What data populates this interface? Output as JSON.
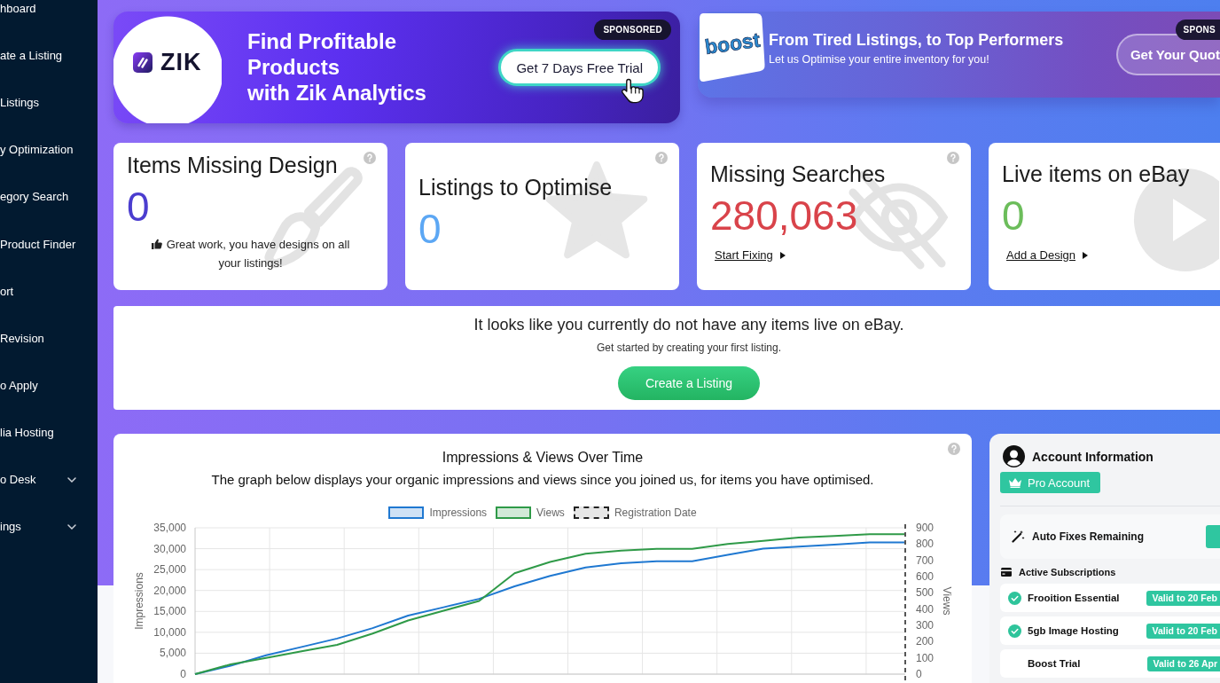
{
  "sidebar": {
    "items": [
      {
        "label": "hboard",
        "kind": "link"
      },
      {
        "label": "ate a Listing",
        "kind": "link"
      },
      {
        "label": "Listings",
        "kind": "link"
      },
      {
        "label": "y Optimization",
        "kind": "link"
      },
      {
        "label": "egory Search",
        "kind": "link"
      },
      {
        "label": "Product Finder",
        "kind": "link"
      },
      {
        "label": "ort",
        "kind": "link"
      },
      {
        "label": "Revision",
        "kind": "link"
      },
      {
        "label": "o Apply",
        "kind": "link"
      },
      {
        "label": "lia Hosting",
        "kind": "link"
      },
      {
        "label": "o Desk",
        "kind": "menu",
        "expanded": false
      },
      {
        "label": "ings",
        "kind": "menu",
        "expanded": false
      }
    ]
  },
  "promotions": [
    {
      "kind": "zik",
      "logo_text": "ZIK",
      "heading_lines": [
        "Find Profitable",
        "Products",
        "with Zik Analytics"
      ],
      "badge": "SPONSORED",
      "button": "Get 7 Days Free Trial"
    },
    {
      "kind": "boost",
      "logo_text": "boost",
      "heading": "From Tired Listings, to Top Performers",
      "subheading": "Let us Optimise your entire inventory for you!",
      "badge": "SPONS",
      "button": "Get Your Quot"
    }
  ],
  "stat_cards": [
    {
      "kind": "design",
      "title": "Items Missing Design",
      "value": "0",
      "color": "#4b3dcf",
      "help": true,
      "note": "Great work, you have designs on all your listings!"
    },
    {
      "kind": "optimise",
      "title": "Listings to Optimise",
      "value": "0",
      "color": "#5ca7f4",
      "help": true
    },
    {
      "kind": "searches",
      "title": "Missing Searches",
      "value": "280,063",
      "color": "#d9434a",
      "help": true,
      "link": "Start Fixing"
    },
    {
      "kind": "live",
      "title": "Live items on eBay",
      "value": "0",
      "color": "#6cbd5b",
      "help": false,
      "link": "Add a Design"
    }
  ],
  "empty_state": {
    "message": "It looks like you currently do not have any items live on eBay.",
    "hint": "Get started by creating your first listing.",
    "button": "Create a Listing"
  },
  "performance_chart": {
    "title": "Impressions & Views Over Time",
    "description": "The graph below displays your organic impressions and views since you joined us, for items you have optimised.",
    "help": true,
    "marker_label": "Registration Date",
    "chart_data": {
      "type": "line",
      "ylabel": "Impressions",
      "y2label": "Views",
      "ylim": [
        0,
        35000
      ],
      "yticks": [
        {
          "value": 0,
          "label": "0"
        },
        {
          "value": 5000,
          "label": "5,000"
        },
        {
          "value": 10000,
          "label": "10,000"
        },
        {
          "value": 15000,
          "label": "15,000"
        },
        {
          "value": 20000,
          "label": "20,000"
        },
        {
          "value": 25000,
          "label": "25,000"
        },
        {
          "value": 30000,
          "label": "30,000"
        },
        {
          "value": 35000,
          "label": "35,000"
        }
      ],
      "y2lim": [
        0,
        900
      ],
      "y2ticks": [
        0,
        100,
        200,
        300,
        400,
        500,
        600,
        700,
        800,
        900
      ],
      "grid": true,
      "legend": true,
      "series": [
        {
          "name": "Impressions",
          "color": "#1f78d1",
          "values": [
            0,
            2000,
            4500,
            6500,
            8500,
            11000,
            14000,
            16000,
            18000,
            21000,
            23500,
            25500,
            26500,
            27000,
            27000,
            28500,
            30000,
            30500,
            31000,
            31500,
            31500
          ]
        },
        {
          "name": "Views",
          "color": "#2f9a48",
          "axis": "y2",
          "values": [
            0,
            60,
            100,
            140,
            180,
            250,
            330,
            390,
            450,
            620,
            690,
            740,
            760,
            770,
            770,
            800,
            820,
            840,
            850,
            860,
            860
          ]
        }
      ]
    }
  },
  "account": {
    "title": "Account Information",
    "plan": "Pro Account",
    "auto_fixes_label": "Auto Fixes Remaining",
    "subscriptions_title": "Active Subscriptions",
    "subscriptions": [
      {
        "name": "Frooition Essential",
        "active": true,
        "validity": "Valid to 20 Feb"
      },
      {
        "name": "5gb Image Hosting",
        "active": true,
        "validity": "Valid to 20 Feb"
      },
      {
        "name": "Boost Trial",
        "active": false,
        "validity": "Valid to 26 Apr"
      }
    ]
  }
}
